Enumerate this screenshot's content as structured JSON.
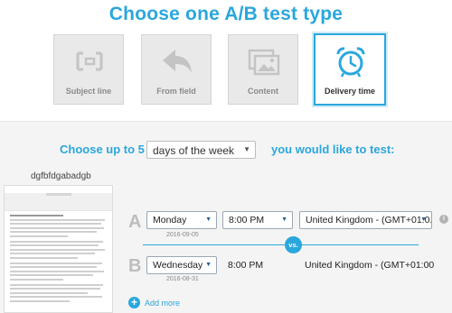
{
  "title": "Choose one A/B test type",
  "test_types": [
    {
      "label": "Subject line",
      "icon": "subject-line-icon",
      "selected": false
    },
    {
      "label": "From field",
      "icon": "reply-arrow-icon",
      "selected": false
    },
    {
      "label": "Content",
      "icon": "images-icon",
      "selected": false
    },
    {
      "label": "Delivery time",
      "icon": "alarm-clock-icon",
      "selected": true
    }
  ],
  "choose": {
    "prefix": "Choose up to 5",
    "select_value": "days of the week",
    "suffix": "you would like to test:"
  },
  "preview": {
    "name": "dgfbfdgabadgb"
  },
  "variants": [
    {
      "letter": "A",
      "day": "Monday",
      "date": "2016-09-05",
      "time": "8:00 PM",
      "timezone": "United Kingdom - (GMT+01:0..."
    },
    {
      "letter": "B",
      "day": "Wednesday",
      "date": "2016-08-31",
      "time": "8:00 PM",
      "timezone": "United Kingdom - (GMT+01:00"
    }
  ],
  "vs_label": "vs.",
  "add_more_label": "Add more",
  "colors": {
    "accent": "#2aa7dd",
    "card_bg": "#e9e9e9",
    "panel_bg": "#f4f4f4",
    "letter": "#bdbdbd"
  }
}
